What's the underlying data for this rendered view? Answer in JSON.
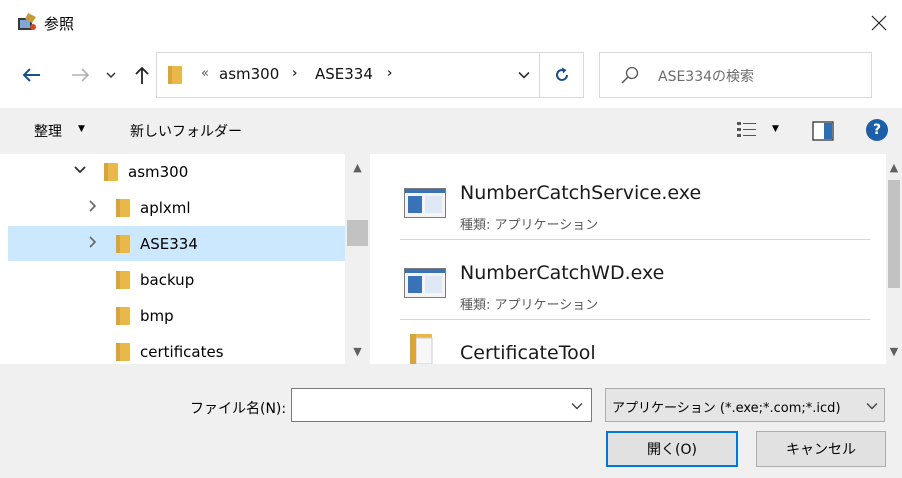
{
  "title_bar": {
    "title": "参照",
    "app_icon": "dialog-app-icon",
    "close_icon": "close-icon"
  },
  "navigation": {
    "back_icon": "back-arrow-icon",
    "forward_icon": "forward-arrow-icon",
    "recent_icon": "chevron-down-icon",
    "up_icon": "up-arrow-icon",
    "address": {
      "overflow": "«",
      "crumbs": [
        "asm300",
        "ASE334"
      ],
      "separator": "›"
    },
    "refresh_icon": "refresh-icon",
    "search": {
      "placeholder": "ASE334の検索"
    }
  },
  "toolbar": {
    "organize_label": "整理",
    "new_folder_label": "新しいフォルダー",
    "help_label": "?"
  },
  "tree": {
    "items": [
      {
        "label": "asm300",
        "expander": "expanded"
      },
      {
        "label": "aplxml",
        "expander": "collapsed"
      },
      {
        "label": "ASE334",
        "expander": "collapsed",
        "selected": true
      },
      {
        "label": "backup",
        "expander": "none"
      },
      {
        "label": "bmp",
        "expander": "none"
      },
      {
        "label": "certificates",
        "expander": "none"
      }
    ]
  },
  "files": {
    "items": [
      {
        "name": "NumberCatchService.exe",
        "type_label": "種類: アプリケーション",
        "icon": "application-icon"
      },
      {
        "name": "NumberCatchWD.exe",
        "type_label": "種類: アプリケーション",
        "icon": "application-icon"
      },
      {
        "name": "CertificateTool",
        "type_label": "",
        "icon": "folder-icon"
      }
    ]
  },
  "bottom": {
    "filename_label": "ファイル名(N):",
    "filename_value": "",
    "filter_value": "アプリケーション (*.exe;*.com;*.icd)",
    "open_label": "開く(O)",
    "cancel_label": "キャンセル"
  },
  "colors": {
    "selection": "#cce8ff",
    "folder": "#e8b84b",
    "accent": "#0078d7",
    "help": "#1c5ea8"
  }
}
